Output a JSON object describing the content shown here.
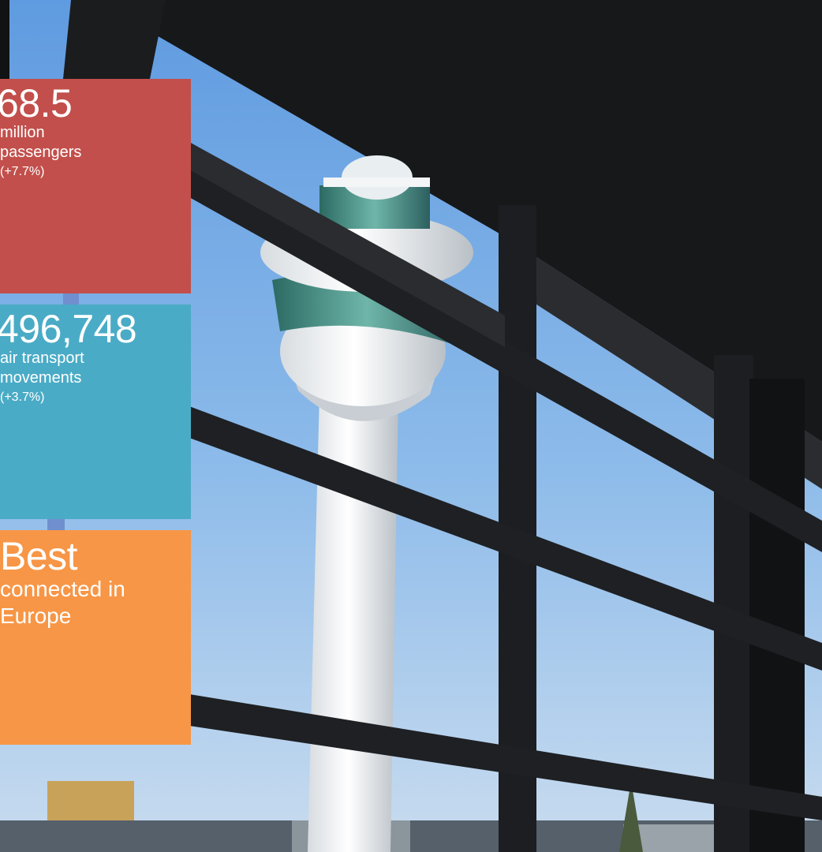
{
  "colors": {
    "passengers_box": "#c24f4b",
    "movements_box": "#4aabc6",
    "connectivity_box": "#f79646",
    "sky": "#7fb3e6",
    "frame": "#1f2124"
  },
  "stats": {
    "passengers": {
      "value": "68.5",
      "line1": "million",
      "line2": "passengers",
      "change": "(+7.7%)"
    },
    "movements": {
      "value": "496,748",
      "line1": "air transport",
      "line2": "movements",
      "change": "(+3.7%)"
    },
    "connectivity": {
      "value": "Best",
      "line1": "connected in",
      "line2": "Europe"
    }
  },
  "background": {
    "icon": "control-tower-photo"
  }
}
